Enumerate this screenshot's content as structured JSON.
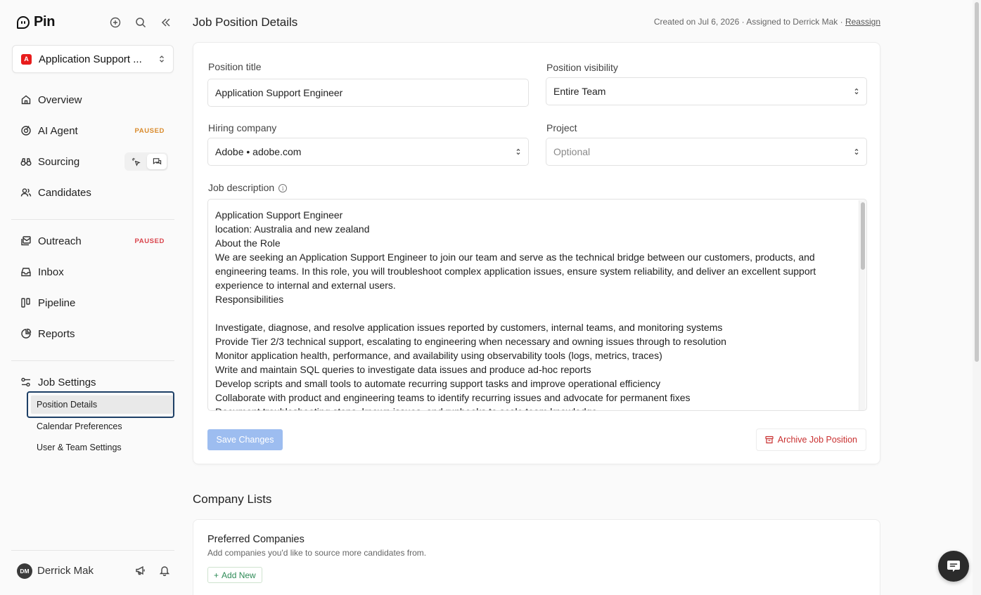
{
  "app": {
    "name": "Pin"
  },
  "job_selector": {
    "label": "Application Support ...",
    "logo_text": "A"
  },
  "nav": {
    "overview": "Overview",
    "ai_agent": "AI Agent",
    "ai_agent_badge": "PAUSED",
    "sourcing": "Sourcing",
    "candidates": "Candidates",
    "outreach": "Outreach",
    "outreach_badge": "PAUSED",
    "inbox": "Inbox",
    "pipeline": "Pipeline",
    "reports": "Reports",
    "job_settings": "Job Settings",
    "sub_items": [
      "Position Details",
      "Calendar Preferences",
      "User & Team Settings"
    ]
  },
  "user": {
    "initials": "DM",
    "name": "Derrick Mak"
  },
  "header": {
    "title": "Job Position Details",
    "meta": "Created on Jul 6, 2026 · Assigned to Derrick Mak · ",
    "reassign": "Reassign"
  },
  "form": {
    "position_title_label": "Position title",
    "position_title_value": "Application Support Engineer",
    "visibility_label": "Position visibility",
    "visibility_value": "Entire Team",
    "hiring_company_label": "Hiring company",
    "hiring_company_value": "Adobe • adobe.com",
    "project_label": "Project",
    "project_placeholder": "Optional",
    "description_label": "Job description",
    "description_lines": [
      "Application Support Engineer",
      "location: Australia and new zealand",
      "About the Role",
      "We are seeking an Application Support Engineer to join our team and serve as the technical bridge between our customers, products, and engineering teams. In this role, you will troubleshoot complex application issues, ensure system reliability, and deliver an excellent support experience to internal and external users.",
      "Responsibilities",
      "",
      "Investigate, diagnose, and resolve application issues reported by customers, internal teams, and monitoring systems",
      "Provide Tier 2/3 technical support, escalating to engineering when necessary and owning issues through to resolution",
      "Monitor application health, performance, and availability using observability tools (logs, metrics, traces)",
      "Write and maintain SQL queries to investigate data issues and produce ad-hoc reports",
      "Develop scripts and small tools to automate recurring support tasks and improve operational efficiency",
      "Collaborate with product and engineering teams to identify recurring issues and advocate for permanent fixes",
      "Document troubleshooting steps, known issues, and runbooks to scale team knowledge"
    ],
    "save_label": "Save Changes",
    "archive_label": "Archive Job Position"
  },
  "company_lists": {
    "title": "Company Lists",
    "preferred_title": "Preferred Companies",
    "preferred_sub": "Add companies you'd like to source more candidates from.",
    "add_label": "Add New"
  },
  "colors": {
    "primary_disabled": "#9dbdf0",
    "danger": "#c93030",
    "badge_orange": "#d98a2b",
    "badge_red": "#d9434b",
    "active_border": "#1d3f66"
  }
}
